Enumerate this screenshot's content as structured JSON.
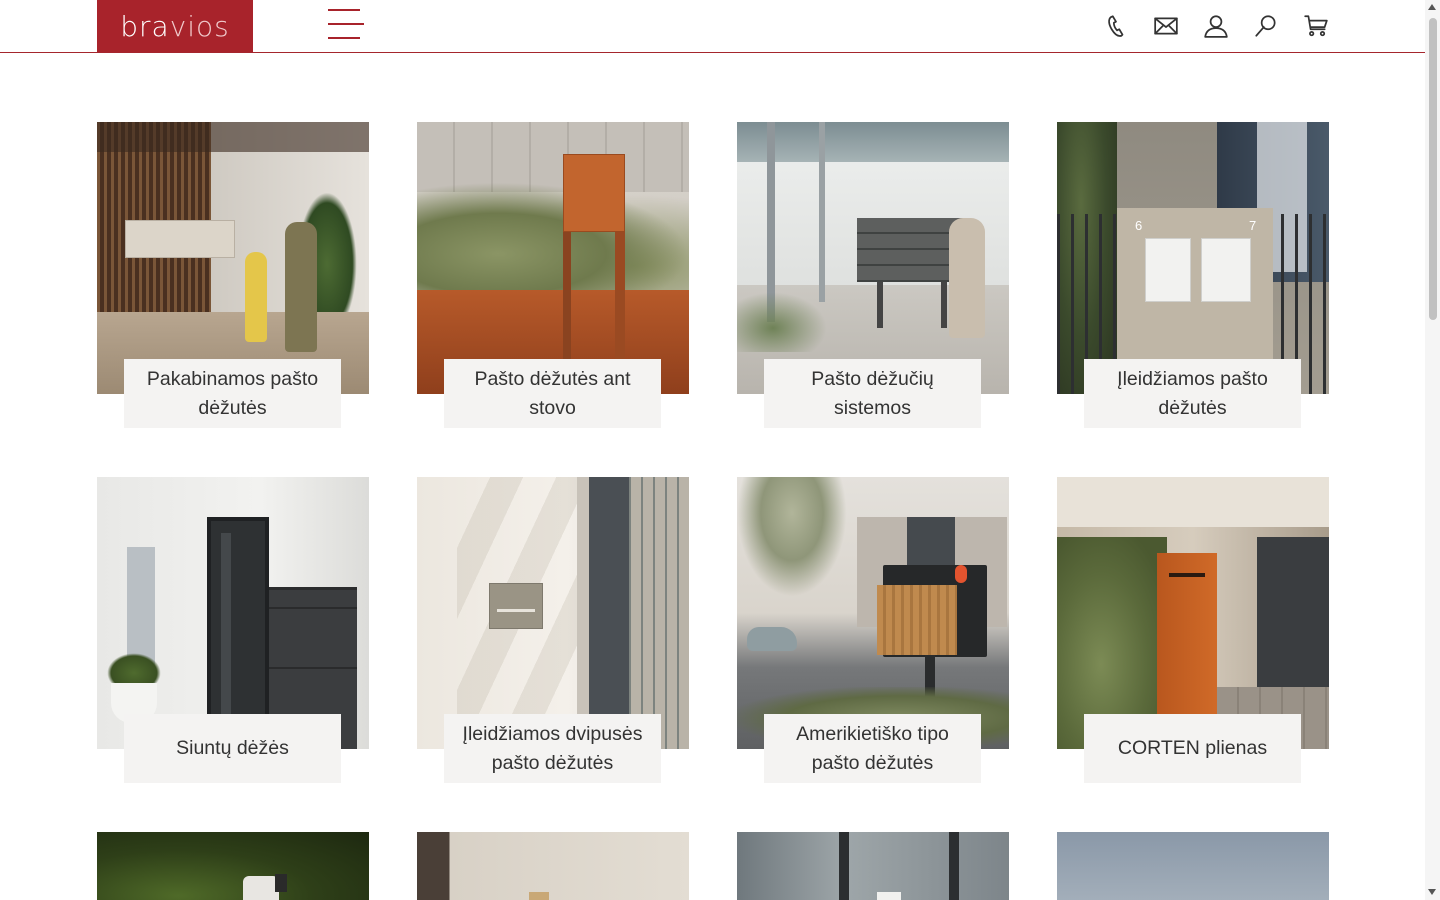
{
  "header": {
    "logo": {
      "text_dark": "bra",
      "text_light": "vios"
    },
    "menu_icon": "hamburger-icon",
    "icons": [
      "phone-icon",
      "mail-icon",
      "user-icon",
      "search-icon",
      "cart-icon"
    ]
  },
  "colors": {
    "brand": "#a8232b",
    "label_bg": "#f4f3f2",
    "text": "#333333"
  },
  "categories": [
    {
      "label": "Pakabinamos pašto dėžutės"
    },
    {
      "label": "Pašto dėžutės ant stovo"
    },
    {
      "label": "Pašto dėžučių sistemos"
    },
    {
      "label": "Įleidžiamos pašto dėžutės"
    },
    {
      "label": "Siuntų dėžės"
    },
    {
      "label": "Įleidžiamos dvipusės pašto dėžutės"
    },
    {
      "label": "Amerikietiško tipo pašto dėžutės"
    },
    {
      "label": "CORTEN plienas"
    }
  ]
}
